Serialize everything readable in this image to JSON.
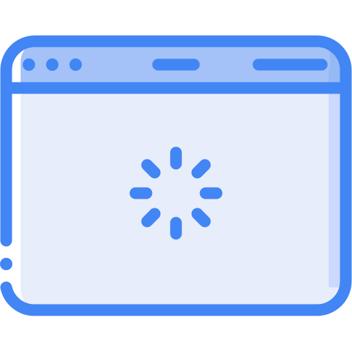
{
  "icon": {
    "name": "browser-window-loading-icon",
    "state": "loading"
  },
  "colors": {
    "outline": "#4285F4",
    "title_bar_fill": "#A4C2F7",
    "window_fill": "#E8EDFC",
    "right_shade": "#CAD9FC",
    "highlight": "#FFFFFF"
  },
  "spinner": {
    "segments": 8
  }
}
